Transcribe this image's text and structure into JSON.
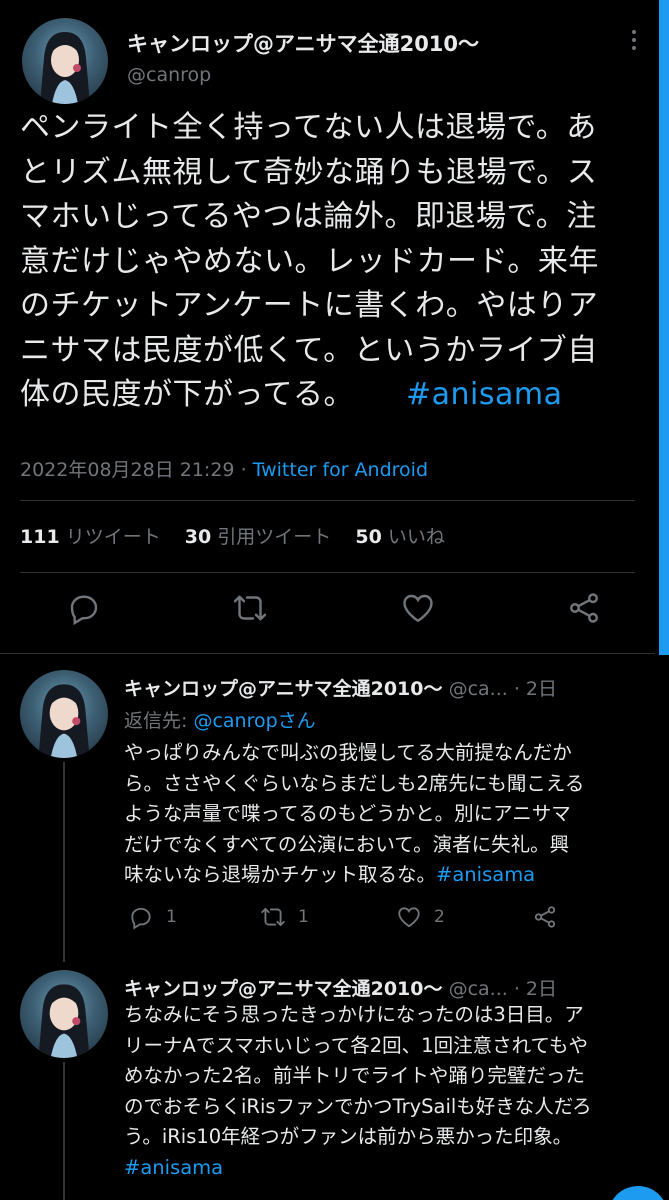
{
  "main": {
    "name": "キャンロップ@アニサマ全通2010〜",
    "handle": "@canrop",
    "text_lines": [
      "ペンライト全く持ってない人は退場で。あ",
      "とリズム無視して奇妙な踊りも退場で。ス",
      "マホいじってるやつは論外。即退場で。注",
      "意だけじゃやめない。レッドカード。来年",
      "のチケットアンケートに書くわ。やはりア",
      "ニサマは民度が低くて。というかライブ自",
      "体の民度が下がってる。"
    ],
    "hashtag": "#anisama",
    "timestamp": "2022年08月28日 21:29",
    "dot": "·",
    "source": "Twitter for Android",
    "retweets_count": "111",
    "retweets_label": "リツイート",
    "quotes_count": "30",
    "quotes_label": "引用ツイート",
    "likes_count": "50",
    "likes_label": "いいね"
  },
  "replies": [
    {
      "name": "キャンロップ@アニサマ全通2010〜",
      "handle": "@ca...",
      "time": "· 2日",
      "replying_prefix": "返信先: ",
      "replying_to": "@canrop",
      "replying_suffix": "さん",
      "text_lines": [
        "やっぱりみんなで叫ぶの我慢してる大前提なんだか",
        "ら。ささやくぐらいならまだしも2席先にも聞こえる",
        "ような声量で喋ってるのもどうかと。別にアニサマ",
        "だけでなくすべての公演において。演者に失礼。興",
        "味ないなら退場かチケット取るな。"
      ],
      "hashtag": "#anisama",
      "reply_count": "1",
      "retweet_count": "1",
      "like_count": "2"
    },
    {
      "name": "キャンロップ@アニサマ全通2010〜",
      "handle": "@ca...",
      "time": "· 2日",
      "text_lines": [
        "ちなみにそう思ったきっかけになったのは3日目。ア",
        "リーナAでスマホいじって各2回、1回注意されてもや",
        "めなかった2名。前半トリでライトや踊り完璧だった",
        "のでおそらくiRisファンでかつTrySailも好きな人だろ",
        "う。iRis10年経つがファンは前から悪かった印象。"
      ],
      "hashtag": "#anisama"
    }
  ],
  "colors": {
    "background": "#000000",
    "text": "#e7e9ea",
    "secondary": "#71767b",
    "accent": "#1d9bf0",
    "border": "#2f3336"
  }
}
